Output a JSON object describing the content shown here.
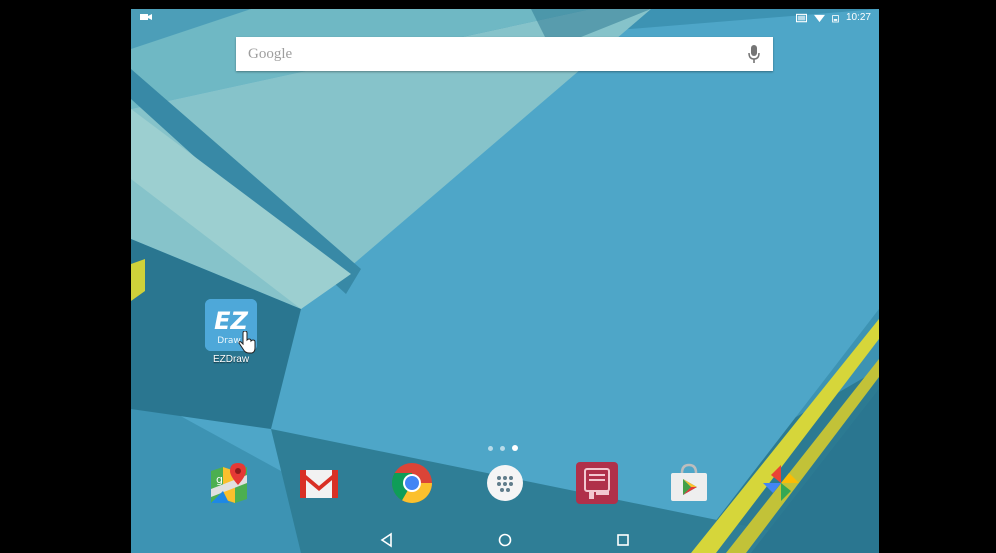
{
  "status_bar": {
    "time": "10:27",
    "left_icon": "video-camera-icon",
    "right_icons": [
      "cast-icon",
      "wifi-icon",
      "battery-icon"
    ]
  },
  "search": {
    "placeholder": "Google",
    "icon": "mic-icon"
  },
  "desktop_apps": [
    {
      "label": "EZDraw",
      "icon": "ezdraw-icon",
      "icon_text_top": "EZ",
      "icon_text_bottom": "Draw"
    }
  ],
  "page_indicator": {
    "pages": 3,
    "active_index": 2
  },
  "dock": [
    {
      "name": "google-maps",
      "icon": "maps-icon"
    },
    {
      "name": "gmail",
      "icon": "gmail-icon"
    },
    {
      "name": "chrome",
      "icon": "chrome-icon"
    },
    {
      "name": "app-drawer",
      "icon": "app-drawer-icon"
    },
    {
      "name": "reader-app",
      "icon": "book-icon"
    },
    {
      "name": "play-store",
      "icon": "play-store-icon"
    },
    {
      "name": "photos",
      "icon": "photos-pinwheel-icon"
    }
  ],
  "nav_bar": [
    "back-icon",
    "home-icon",
    "recents-icon"
  ],
  "colors": {
    "wallpaper_dark": "#2f7e96",
    "wallpaper_mid": "#4ea6c8",
    "wallpaper_light": "#86c3ca",
    "accent_yellow": "#d6d63a",
    "ezdraw_blue": "#4ea8d9"
  }
}
